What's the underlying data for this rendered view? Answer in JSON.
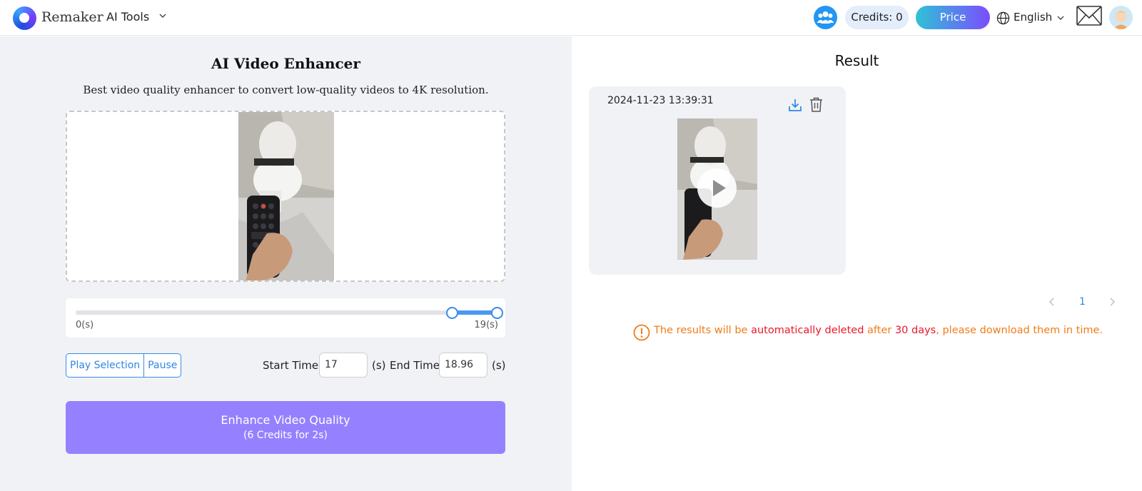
{
  "header": {
    "brand": "Remaker",
    "menu_label": "AI Tools",
    "credits_label": "Credits: 0",
    "price_label": "Price",
    "language": "English"
  },
  "tool": {
    "title": "AI Video Enhancer",
    "subtitle": "Best video quality enhancer to convert low-quality videos to 4K resolution."
  },
  "slider": {
    "min_label": "0(s)",
    "max_label": "19(s)",
    "range_start": 17,
    "range_end": 18.96,
    "max": 19
  },
  "controls": {
    "play_selection_label": "Play Selection",
    "pause_label": "Pause",
    "start_time_label": "Start Time",
    "start_time_value": "17",
    "end_time_label": "End Time",
    "end_time_value": "18.96",
    "unit": "(s)"
  },
  "enhance_button": {
    "line1": "Enhance Video Quality",
    "line2": "(6 Credits for 2s)"
  },
  "result": {
    "title": "Result",
    "timestamp": "2024-11-23 13:39:31",
    "page": "1"
  },
  "notice": {
    "part1": "The results will be ",
    "part2": "automatically deleted",
    "part3": " after ",
    "part4": "30 days",
    "part5": ", please download them in time."
  },
  "colors": {
    "accent": "#2f86e6",
    "enhance": "#9581ff",
    "warning": "#f07c18",
    "danger": "#e8182b"
  }
}
